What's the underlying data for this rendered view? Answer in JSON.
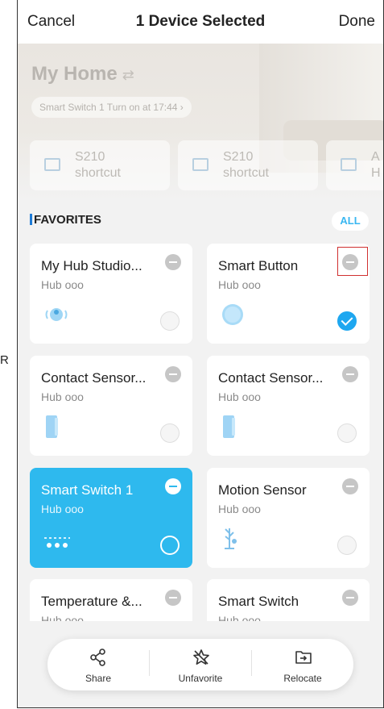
{
  "stray_char": "R",
  "topbar": {
    "cancel": "Cancel",
    "title": "1 Device Selected",
    "done": "Done"
  },
  "home": {
    "name": "My Home",
    "swap_icon": "⇄",
    "status_pill": "Smart Switch 1 Turn on at 17:44 ›"
  },
  "shortcuts": [
    {
      "line1": "S210",
      "line2": "shortcut"
    },
    {
      "line1": "S210",
      "line2": "shortcut"
    },
    {
      "line1": "A",
      "line2": "H"
    }
  ],
  "favorites": {
    "label": "FAVORITES",
    "all": "ALL"
  },
  "devices": [
    {
      "name": "My Hub Studio...",
      "hub": "Hub ooo",
      "icon": "hub-device-icon",
      "selected": false,
      "active": false
    },
    {
      "name": "Smart Button",
      "hub": "Hub ooo",
      "icon": "smart-button-device-icon",
      "selected": true,
      "active": false
    },
    {
      "name": "Contact Sensor...",
      "hub": "Hub ooo",
      "icon": "contact-sensor-device-icon",
      "selected": false,
      "active": false
    },
    {
      "name": "Contact Sensor...",
      "hub": "Hub ooo",
      "icon": "contact-sensor-device-icon",
      "selected": false,
      "active": false
    },
    {
      "name": "Smart Switch 1",
      "hub": "Hub ooo",
      "icon": "smart-switch-device-icon",
      "selected": false,
      "active": true
    },
    {
      "name": "Motion Sensor",
      "hub": "Hub ooo",
      "icon": "motion-sensor-device-icon",
      "selected": false,
      "active": false
    },
    {
      "name": "Temperature &...",
      "hub": "Hub ooo",
      "icon": "temperature-sensor-device-icon",
      "selected": false,
      "active": false
    },
    {
      "name": "Smart Switch",
      "hub": "Hub ooo",
      "icon": "smart-switch-device-icon",
      "selected": false,
      "active": false
    }
  ],
  "toolbar": {
    "share": "Share",
    "unfavorite": "Unfavorite",
    "relocate": "Relocate"
  },
  "colors": {
    "accent": "#2eb9ee",
    "check_blue": "#1ea7f0",
    "fav_bar": "#1e7bd6",
    "highlight_box": "#d03030"
  }
}
